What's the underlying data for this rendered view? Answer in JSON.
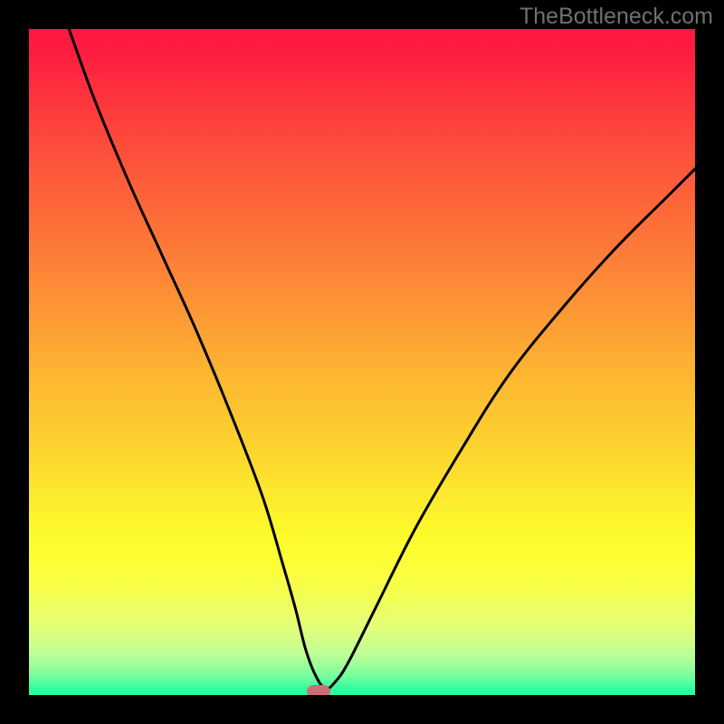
{
  "watermark": "TheBottleneck.com",
  "colors": {
    "frame": "#000000",
    "curve": "#000000",
    "marker": "#cc6f77",
    "gradient_top": "#fe163e",
    "gradient_bottom": "#27fda0"
  },
  "chart_data": {
    "type": "line",
    "title": "",
    "xlabel": "",
    "ylabel": "",
    "xlim": [
      0,
      100
    ],
    "ylim": [
      0,
      100
    ],
    "series": [
      {
        "name": "curve",
        "x": [
          6,
          10,
          15,
          20,
          25,
          30,
          35,
          38,
          40,
          41.5,
          43,
          44.5,
          46,
          48,
          52,
          58,
          65,
          72,
          80,
          88,
          96,
          100
        ],
        "y": [
          100,
          89,
          77,
          66,
          55,
          43,
          30,
          20,
          13,
          7,
          3,
          1,
          2,
          5,
          13,
          25,
          37,
          48,
          58,
          67,
          75,
          79
        ]
      }
    ],
    "marker": {
      "x": 43.5,
      "y": 0.5
    },
    "annotations": []
  }
}
